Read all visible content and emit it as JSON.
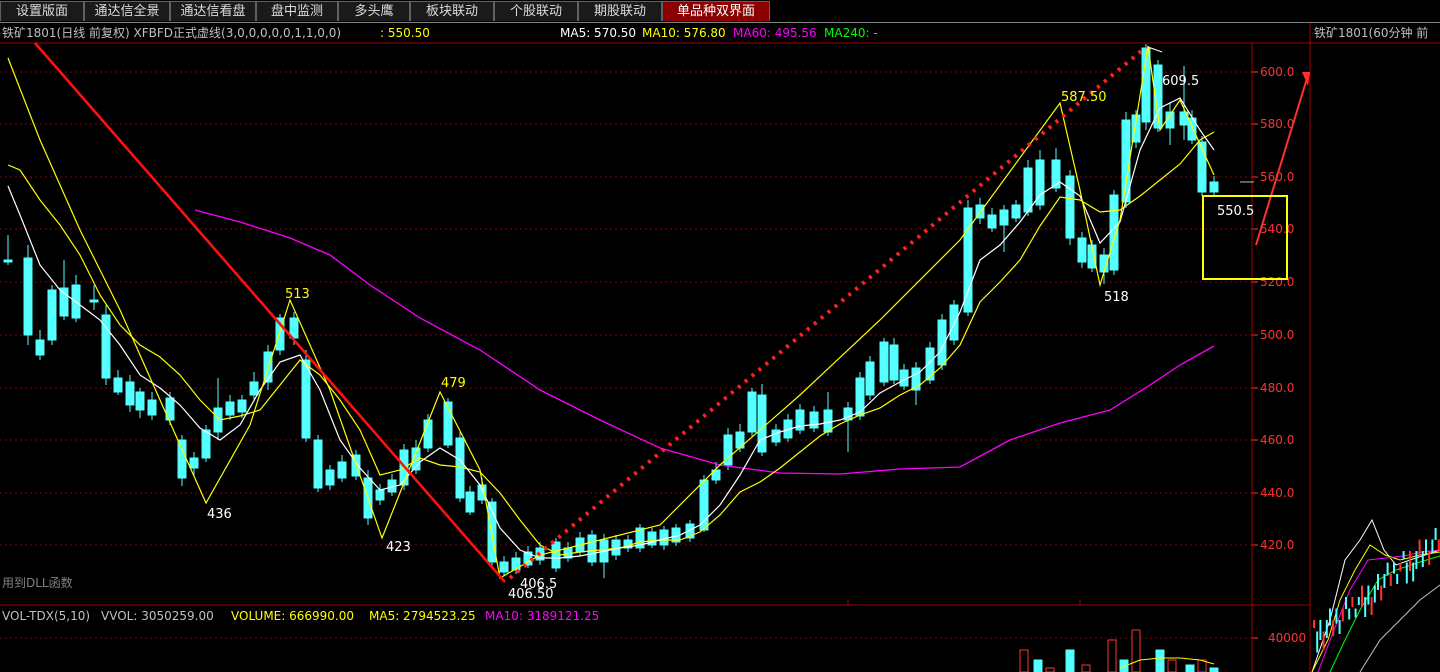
{
  "tabs": [
    {
      "label": "设置版面",
      "active": false
    },
    {
      "label": "通达信全景",
      "active": false
    },
    {
      "label": "通达信看盘",
      "active": false
    },
    {
      "label": "盘中监测",
      "active": false
    },
    {
      "label": "多头鹰",
      "active": false
    },
    {
      "label": "板块联动",
      "active": false
    },
    {
      "label": "个股联动",
      "active": false
    },
    {
      "label": "期股联动",
      "active": false
    },
    {
      "label": "单品种双界面",
      "active": true
    }
  ],
  "main_chart": {
    "title": "铁矿1801(日线 前复权) XFBFD正式虚线(3,0,0,0,0,0,1,1,0,0)",
    "price_label": ": 550.50",
    "ma5": "MA5: 570.50",
    "ma10": "MA10: 576.80",
    "ma60": "MA60: 495.56",
    "ma240": "MA240: -",
    "dll_note": "用到DLL函数",
    "annotations": [
      {
        "text": "513",
        "color": "#ffff00"
      },
      {
        "text": "479",
        "color": "#ffff00"
      },
      {
        "text": "587.50",
        "color": "#ffff00"
      },
      {
        "text": "609.5",
        "color": "#ffffff"
      },
      {
        "text": "436",
        "color": "#ffffff"
      },
      {
        "text": "423",
        "color": "#ffffff"
      },
      {
        "text": "406.5",
        "color": "#ffffff"
      },
      {
        "text": "406.50",
        "color": "#ffffff"
      },
      {
        "text": "518",
        "color": "#ffffff"
      },
      {
        "text": "550.5",
        "color": "#ffffff"
      }
    ],
    "price_axis": [
      "600.0",
      "580.0",
      "560.0",
      "540.0",
      "520.0",
      "500.0",
      "480.0",
      "460.0",
      "440.0",
      "420.0"
    ]
  },
  "volume_chart": {
    "label": "VOL-TDX(5,10)",
    "vvol": "VVOL: 3050259.00",
    "volume": "VOLUME: 666990.00",
    "ma5": "MA5: 2794523.25",
    "ma10": "MA10: 3189121.25",
    "axis": [
      "40000"
    ]
  },
  "side_chart": {
    "title": "铁矿1801(60分钟 前"
  },
  "colors": {
    "up": "#ff3232",
    "down": "#54ffff",
    "ma5": "#ffffff",
    "ma10": "#ffff00",
    "ma60": "#ff00ff",
    "grid": "#8b0000",
    "axis_text": "#ff3232",
    "trend": "#ff0000"
  }
}
